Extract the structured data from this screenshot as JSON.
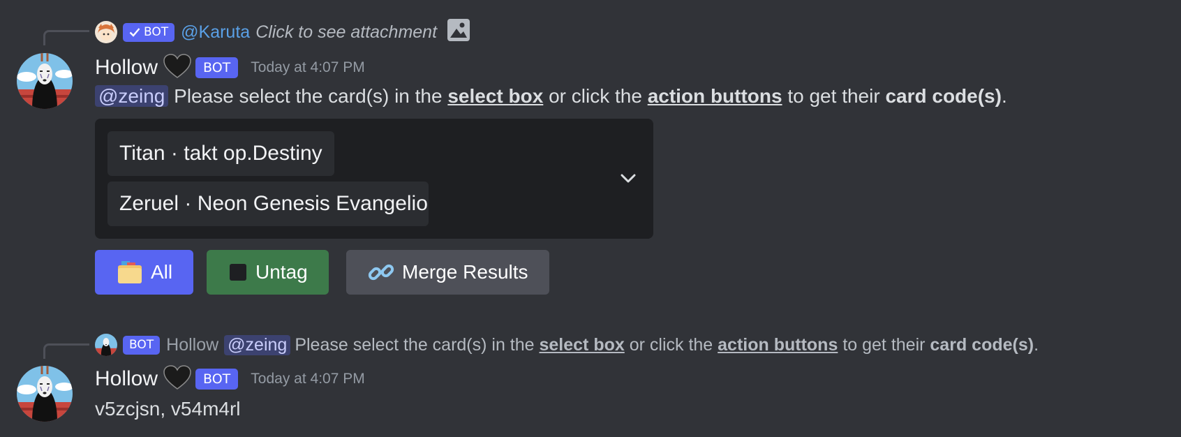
{
  "message1": {
    "reply": {
      "badge": "BOT",
      "author": "@Karuta",
      "text": "Click to see attachment"
    },
    "author": "Hollow",
    "badge": "BOT",
    "timestamp": "Today at 4:07 PM",
    "content": {
      "mention": "@zeing",
      "t1": " Please select the card(s) in the ",
      "select_box": "select box",
      "t2": " or click the ",
      "action_buttons": "action buttons",
      "t3": " to get their ",
      "card_codes": "card code(s)",
      "t4": "."
    },
    "select": {
      "selected": [
        "Titan · takt op.Destiny",
        "Zeruel · Neon Genesis Evangelion"
      ]
    },
    "buttons": [
      {
        "label": "All",
        "color": "#5865f2",
        "icon": "file-box-icon"
      },
      {
        "label": "Untag",
        "color": "#3d7a4a",
        "icon": "black-square-icon"
      },
      {
        "label": "Merge Results",
        "color": "#4e5058",
        "icon": "chain-link-icon"
      }
    ]
  },
  "message2": {
    "reply": {
      "badge": "BOT",
      "author": "Hollow",
      "mention": "@zeing",
      "t1": " Please select the card(s) in the ",
      "select_box": "select box",
      "t2": " or click the ",
      "action_buttons": "action buttons",
      "t3": " to get their ",
      "card_codes": "card code(s)",
      "t4": "."
    },
    "author": "Hollow",
    "badge": "BOT",
    "timestamp": "Today at 4:07 PM",
    "content": "v5zcjsn, v54m4rl"
  }
}
